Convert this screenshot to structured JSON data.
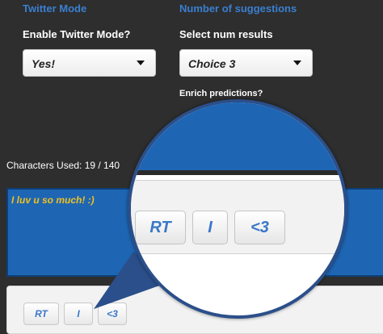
{
  "twitter_mode": {
    "section_title": "Twitter Mode",
    "label": "Enable Twitter Mode?",
    "selected": "Yes!"
  },
  "num_suggestions": {
    "section_title": "Number of suggestions",
    "label": "Select num results",
    "selected": "Choice 3"
  },
  "enrich": {
    "label": "Enrich predictions?"
  },
  "counter": {
    "text": "Characters Used:  19 / 140"
  },
  "tweet": {
    "text": "I luv u so much! :)"
  },
  "suggestions": [
    "RT",
    "I",
    "<3"
  ],
  "magnifier": {
    "suggestions": [
      "RT",
      "I",
      "<3"
    ]
  },
  "colors": {
    "accent": "#3a7fd0",
    "background": "#2e2e2e",
    "tweet_area": "#1e66b4",
    "tweet_text": "#f0c020"
  },
  "icons": [
    "chevron-down-icon",
    "magnifier-lens"
  ]
}
